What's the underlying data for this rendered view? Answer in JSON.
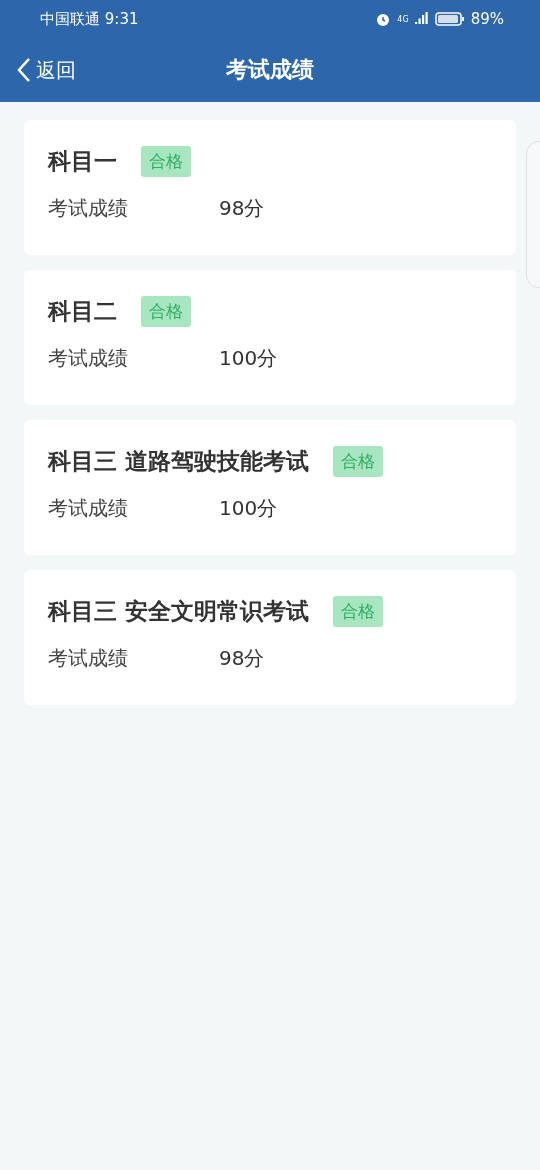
{
  "status_bar": {
    "carrier": "中国联通",
    "time": "9:31",
    "network": "4G",
    "battery": "89%"
  },
  "header": {
    "back": "返回",
    "title": "考试成绩"
  },
  "results": [
    {
      "subject": "科目一",
      "status": "合格",
      "passed": true,
      "label": "考试成绩",
      "score": "98分"
    },
    {
      "subject": "科目二",
      "status": "合格",
      "passed": true,
      "label": "考试成绩",
      "score": "100分"
    },
    {
      "subject": "科目三 道路驾驶技能考试",
      "status": "合格",
      "passed": true,
      "label": "考试成绩",
      "score": "100分"
    },
    {
      "subject": "科目三 安全文明常识考试",
      "status": "合格",
      "passed": true,
      "label": "考试成绩",
      "score": "98分"
    }
  ]
}
